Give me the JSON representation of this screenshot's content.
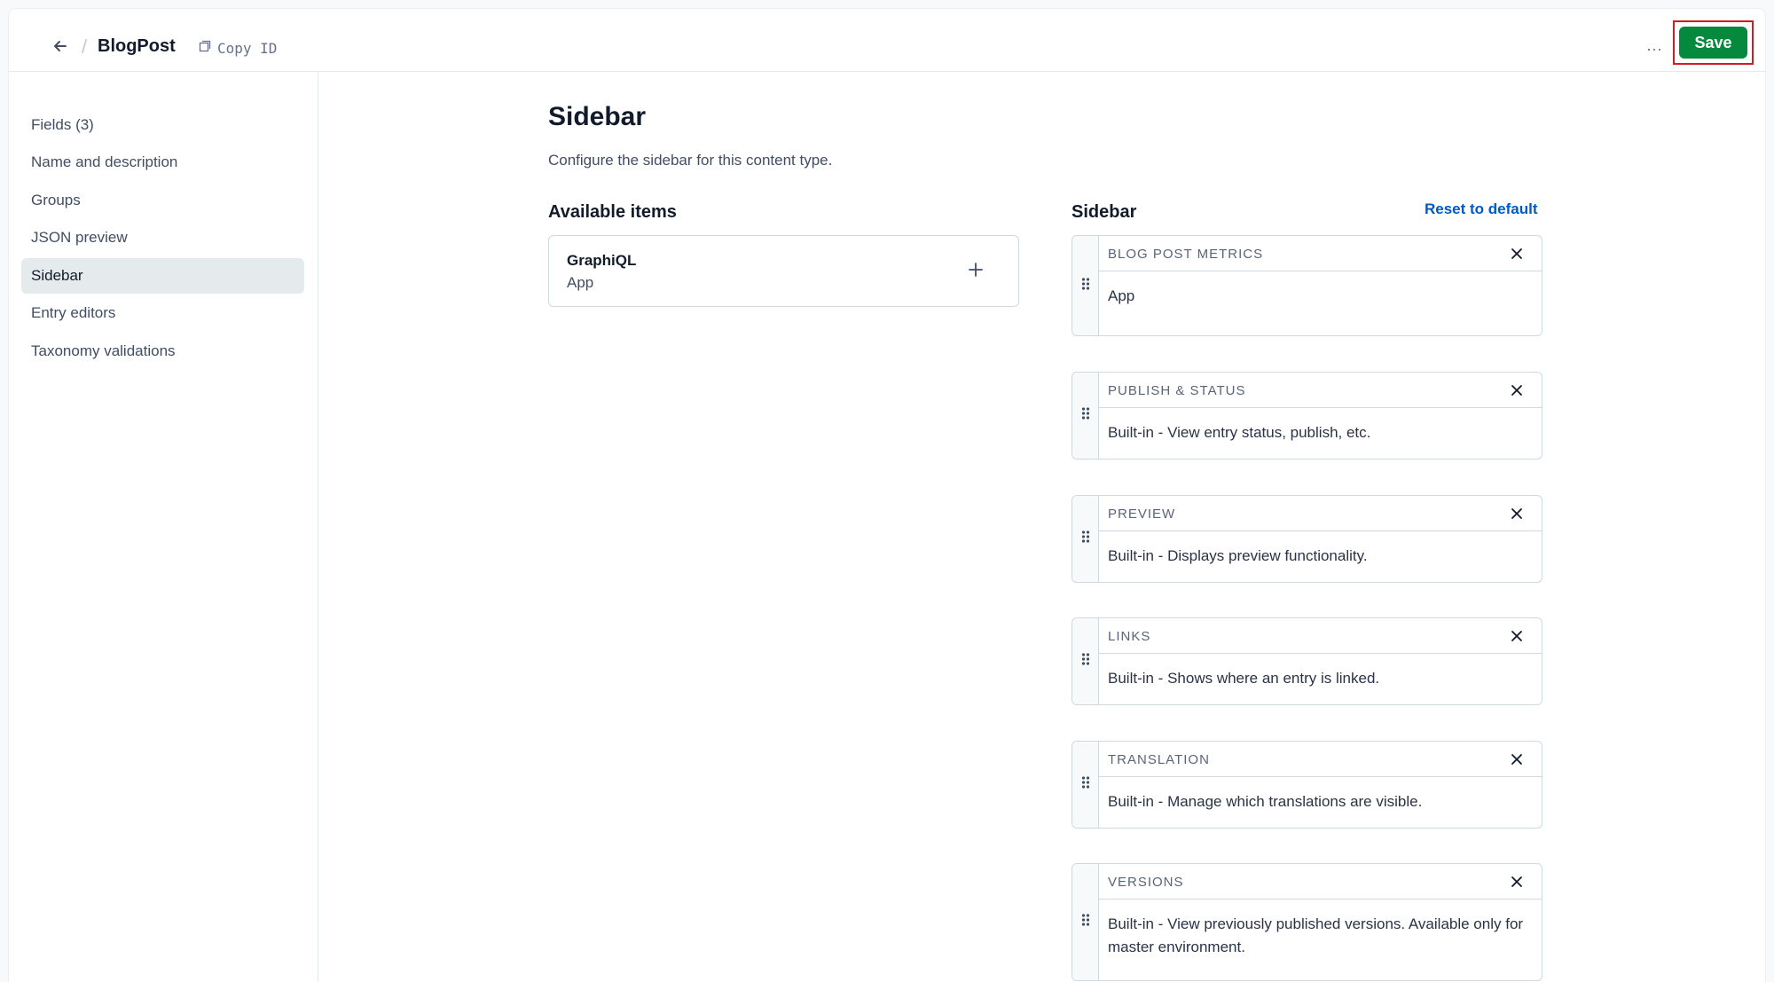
{
  "header": {
    "title": "BlogPost",
    "copy_id_label": "Copy ID",
    "more_label": "···",
    "save_label": "Save"
  },
  "nav": {
    "items": [
      {
        "label": "Fields (3)",
        "active": false
      },
      {
        "label": "Name and description",
        "active": false
      },
      {
        "label": "Groups",
        "active": false
      },
      {
        "label": "JSON preview",
        "active": false
      },
      {
        "label": "Sidebar",
        "active": true
      },
      {
        "label": "Entry editors",
        "active": false
      },
      {
        "label": "Taxonomy validations",
        "active": false
      }
    ]
  },
  "main": {
    "title": "Sidebar",
    "description": "Configure the sidebar for this content type.",
    "available_heading": "Available items",
    "sidebar_heading": "Sidebar",
    "reset_label": "Reset to default",
    "available_items": [
      {
        "name": "GraphiQL",
        "type": "App"
      }
    ],
    "sidebar_items": [
      {
        "label": "BLOG POST METRICS",
        "description": "App"
      },
      {
        "label": "PUBLISH & STATUS",
        "description": "Built-in - View entry status, publish, etc."
      },
      {
        "label": "PREVIEW",
        "description": "Built-in - Displays preview functionality."
      },
      {
        "label": "LINKS",
        "description": "Built-in - Shows where an entry is linked."
      },
      {
        "label": "TRANSLATION",
        "description": "Built-in - Manage which translations are visible."
      },
      {
        "label": "VERSIONS",
        "description": "Built-in - View previously published versions. Available only for master environment."
      }
    ]
  },
  "colors": {
    "accent_save": "#058a3d",
    "link": "#0059c8",
    "highlight_box": "#d21c24",
    "nav_active_bg": "#e5ebed"
  }
}
